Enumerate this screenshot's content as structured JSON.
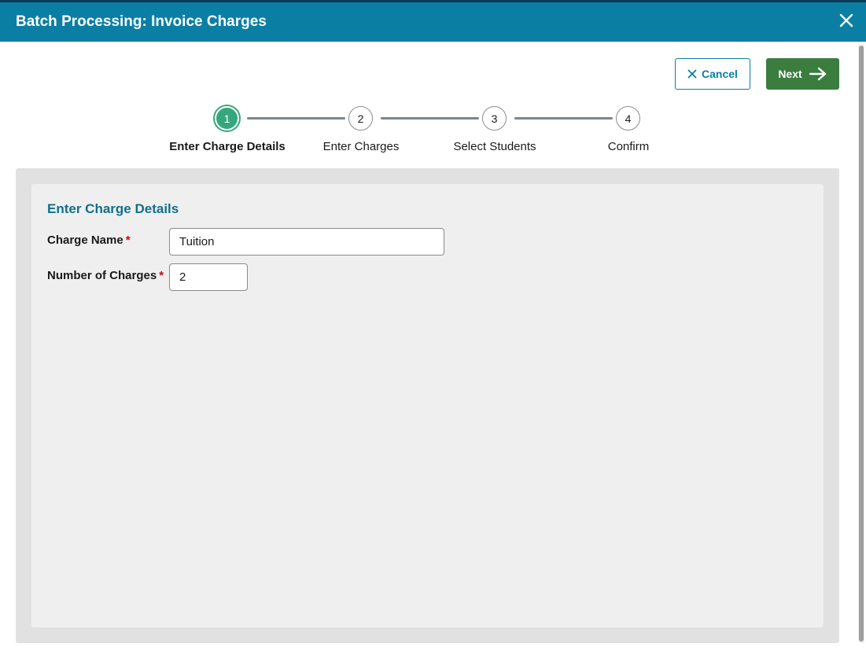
{
  "dialog": {
    "title": "Batch Processing: Invoice Charges",
    "close_icon": "close-icon"
  },
  "toolbar": {
    "cancel_label": "Cancel",
    "cancel_icon": "x-icon",
    "next_label": "Next",
    "next_icon": "arrow-right-icon"
  },
  "stepper": {
    "active_index": 0,
    "steps": [
      {
        "number": "1",
        "label": "Enter Charge Details"
      },
      {
        "number": "2",
        "label": "Enter Charges"
      },
      {
        "number": "3",
        "label": "Select Students"
      },
      {
        "number": "4",
        "label": "Confirm"
      }
    ]
  },
  "form": {
    "section_title": "Enter Charge Details",
    "charge_name": {
      "label": "Charge Name",
      "required_marker": "*",
      "value": "Tuition"
    },
    "number_of_charges": {
      "label": "Number of Charges",
      "required_marker": "*",
      "value": "2"
    }
  },
  "colors": {
    "header": "#0a7fa3",
    "primary_button": "#3a7d3f",
    "active_step": "#35a77c",
    "section_title": "#126f8a",
    "required": "#d40000"
  }
}
